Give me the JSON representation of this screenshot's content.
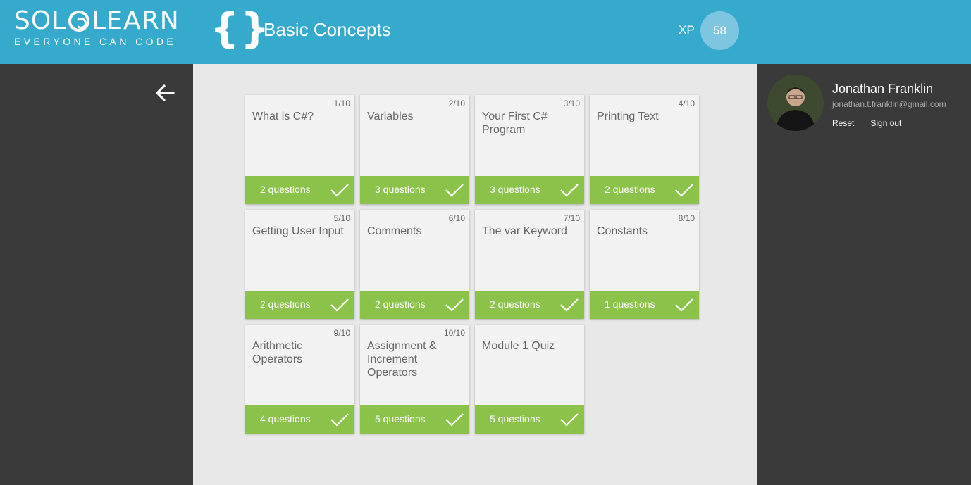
{
  "header": {
    "logo_main_left": "SOL",
    "logo_main_right": "LEARN",
    "logo_tagline": "EVERYONE CAN CODE",
    "title": "Basic Concepts",
    "xp_label": "XP",
    "xp_value": "58",
    "accent_color": "#35aacd"
  },
  "user": {
    "name": "Jonathan Franklin",
    "email": "jonathan.t.franklin@gmail.com",
    "reset_label": "Reset",
    "signout_label": "Sign out"
  },
  "lessons": [
    {
      "index": "1/10",
      "title": "What is C#?",
      "questions": "2 questions",
      "completed": true
    },
    {
      "index": "2/10",
      "title": "Variables",
      "questions": "3 questions",
      "completed": true
    },
    {
      "index": "3/10",
      "title": "Your First C# Program",
      "questions": "3 questions",
      "completed": true
    },
    {
      "index": "4/10",
      "title": "Printing Text",
      "questions": "2 questions",
      "completed": true
    },
    {
      "index": "5/10",
      "title": "Getting User Input",
      "questions": "2 questions",
      "completed": true
    },
    {
      "index": "6/10",
      "title": "Comments",
      "questions": "2 questions",
      "completed": true
    },
    {
      "index": "7/10",
      "title": "The var Keyword",
      "questions": "2 questions",
      "completed": true
    },
    {
      "index": "8/10",
      "title": "Constants",
      "questions": "1 questions",
      "completed": true
    },
    {
      "index": "9/10",
      "title": "Arithmetic Operators",
      "questions": "4 questions",
      "completed": true
    },
    {
      "index": "10/10",
      "title": "Assignment & Increment Operators",
      "questions": "5 questions",
      "completed": true
    },
    {
      "index": "",
      "title": "Module 1 Quiz",
      "questions": "5 questions",
      "completed": true
    }
  ],
  "colors": {
    "completed_footer": "#8bc34a",
    "side_panel": "#3a3a3a",
    "main_bg": "#e8e8e8"
  }
}
